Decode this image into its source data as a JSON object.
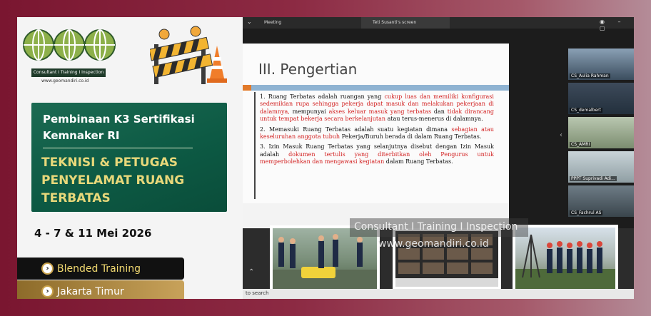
{
  "brand": {
    "tagline": "Consultant I Training I Inspection",
    "url": "www.geomandiri.co.id"
  },
  "course": {
    "program": "Pembinaan K3 Sertifikasi Kemnaker RI",
    "title": "TEKNISI & PETUGAS PENYELAMAT RUANG TERBATAS",
    "date": "4 - 7 & 11 Mei 2026",
    "mode": "Blended Training",
    "location": "Jakarta Timur"
  },
  "meeting": {
    "tabs": [
      "Meeting",
      "Teti Susanti's screen"
    ],
    "slide": {
      "heading": "III. Pengertian",
      "items": [
        {
          "num": "1.",
          "parts": [
            {
              "t": "Ruang Terbatas adalah ruangan yang ",
              "red": false
            },
            {
              "t": "cukup luas dan memiliki konfigurasi sedemikian rupa sehingga pekerja dapat masuk dan melakukan pekerjaan di dalamnya,",
              "red": true
            },
            {
              "t": " mempunyai ",
              "red": false
            },
            {
              "t": "akses keluar masuk yang terbatas",
              "red": true
            },
            {
              "t": " dan ",
              "red": false
            },
            {
              "t": "tidak dirancang untuk tempat bekerja secara berkelanjutan",
              "red": true
            },
            {
              "t": " atau terus-menerus di dalamnya.",
              "red": false
            }
          ]
        },
        {
          "num": "2.",
          "parts": [
            {
              "t": "Memasuki Ruang Terbatas adalah suatu kegiatan dimana ",
              "red": false
            },
            {
              "t": "sebagian atau keseluruhan anggota tubuh",
              "red": true
            },
            {
              "t": " Pekerja/Buruh berada di dalam Ruang Terbatas.",
              "red": false
            }
          ]
        },
        {
          "num": "3.",
          "parts": [
            {
              "t": "Izin Masuk Ruang Terbatas yang selanjutnya disebut dengan Izin Masuk adalah ",
              "red": false
            },
            {
              "t": "dokumen tertulis yang diterbitkan oleh Pengurus untuk memperbolehkan dan mengawasi kegiatan",
              "red": true
            },
            {
              "t": " dalam Ruang Terbatas.",
              "red": false
            }
          ]
        }
      ]
    },
    "watermark": "Consultant I Training I Inspection",
    "watermark_url": "www.geomandiri.co.id",
    "participants": [
      "CS_Aulia Rahman",
      "CS_demalbert",
      "CS_AMRI",
      "PPPT Suprivadi Adi...",
      "CS_Fachrul AS"
    ],
    "search": "to search"
  },
  "colors": {
    "maroon": "#7a1630",
    "green": "#0d5a44",
    "gold": "#e8d87a",
    "red_text": "#d21f1f"
  }
}
